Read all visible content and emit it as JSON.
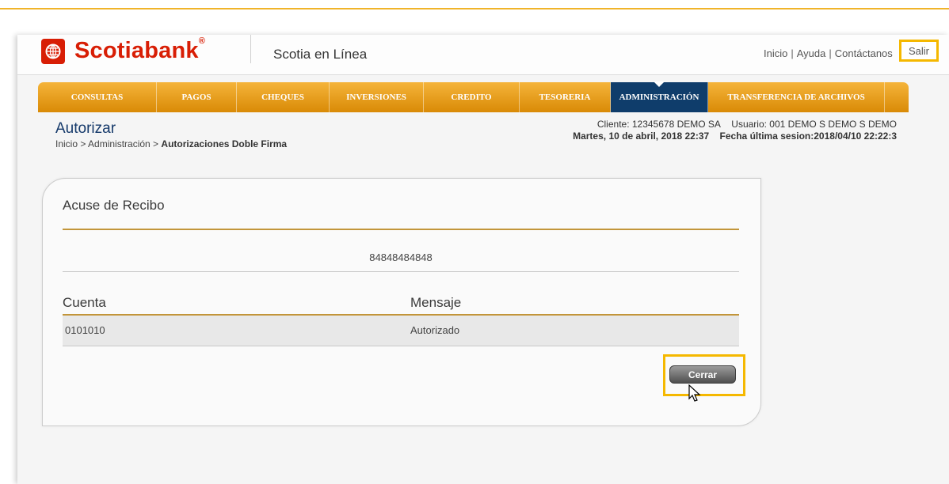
{
  "brand": {
    "name": "Scotiabank",
    "registered_mark": "®",
    "app_name": "Scotia en Línea",
    "color_red": "#d81e05",
    "color_gold": "#f0a81e",
    "color_navy": "#0f3d6b",
    "highlight_color": "#f5b800"
  },
  "top_links": {
    "inicio": "Inicio",
    "ayuda": "Ayuda",
    "contactanos": "Contáctanos",
    "separator": "|",
    "salir": "Salir"
  },
  "nav": {
    "items": [
      {
        "label": "CONSULTAS",
        "active": false
      },
      {
        "label": "PAGOS",
        "active": false
      },
      {
        "label": "CHEQUES",
        "active": false
      },
      {
        "label": "INVERSIONES",
        "active": false
      },
      {
        "label": "CREDITO",
        "active": false
      },
      {
        "label": "TESORERIA",
        "active": false
      },
      {
        "label": "ADMINISTRACIÓN",
        "active": true
      },
      {
        "label": "TRANSFERENCIA DE ARCHIVOS",
        "active": false
      }
    ]
  },
  "page": {
    "title": "Autorizar",
    "breadcrumb_prefix": "Inicio > Administración > ",
    "breadcrumb_current": "Autorizaciones Doble Firma"
  },
  "session": {
    "cliente": "Cliente: 12345678  DEMO SA",
    "usuario": "Usuario: 001 DEMO S DEMO S DEMO",
    "fecha": "Martes, 10 de abril, 2018 22:37",
    "ultima_sesion": "Fecha última sesion:2018/04/10 22:22:3"
  },
  "receipt": {
    "title": "Acuse de Recibo",
    "reference": "84848484848",
    "columns": [
      "Cuenta",
      "Mensaje"
    ],
    "rows": [
      {
        "cuenta": "0101010",
        "mensaje": "Autorizado"
      }
    ],
    "close_button": "Cerrar"
  }
}
